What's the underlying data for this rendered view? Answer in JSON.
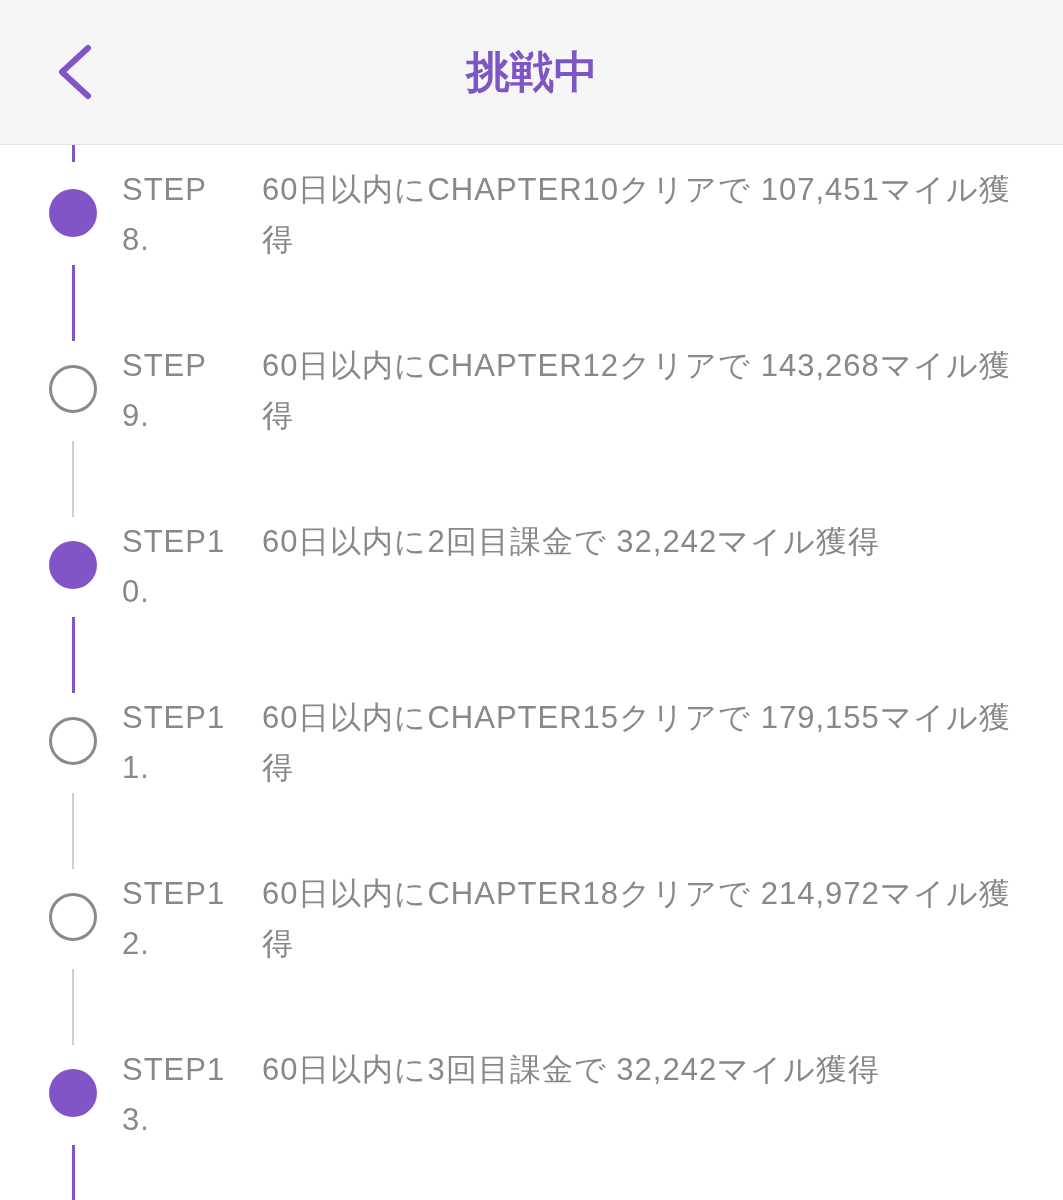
{
  "header": {
    "title": "挑戦中"
  },
  "steps": [
    {
      "label": "STEP 8.",
      "text": "60日以内にCHAPTER10クリアで 107,451マイル獲得",
      "done": true
    },
    {
      "label": "STEP 9.",
      "text": "60日以内にCHAPTER12クリアで 143,268マイル獲得",
      "done": false
    },
    {
      "label": "STEP10.",
      "text": "60日以内に2回目課金で 32,242マイル獲得",
      "done": true
    },
    {
      "label": "STEP11.",
      "text": "60日以内にCHAPTER15クリアで 179,155マイル獲得",
      "done": false
    },
    {
      "label": "STEP12.",
      "text": "60日以内にCHAPTER18クリアで 214,972マイル獲得",
      "done": false
    },
    {
      "label": "STEP13.",
      "text": "60日以内に3回目課金で 32,242マイル獲得",
      "done": true
    }
  ]
}
